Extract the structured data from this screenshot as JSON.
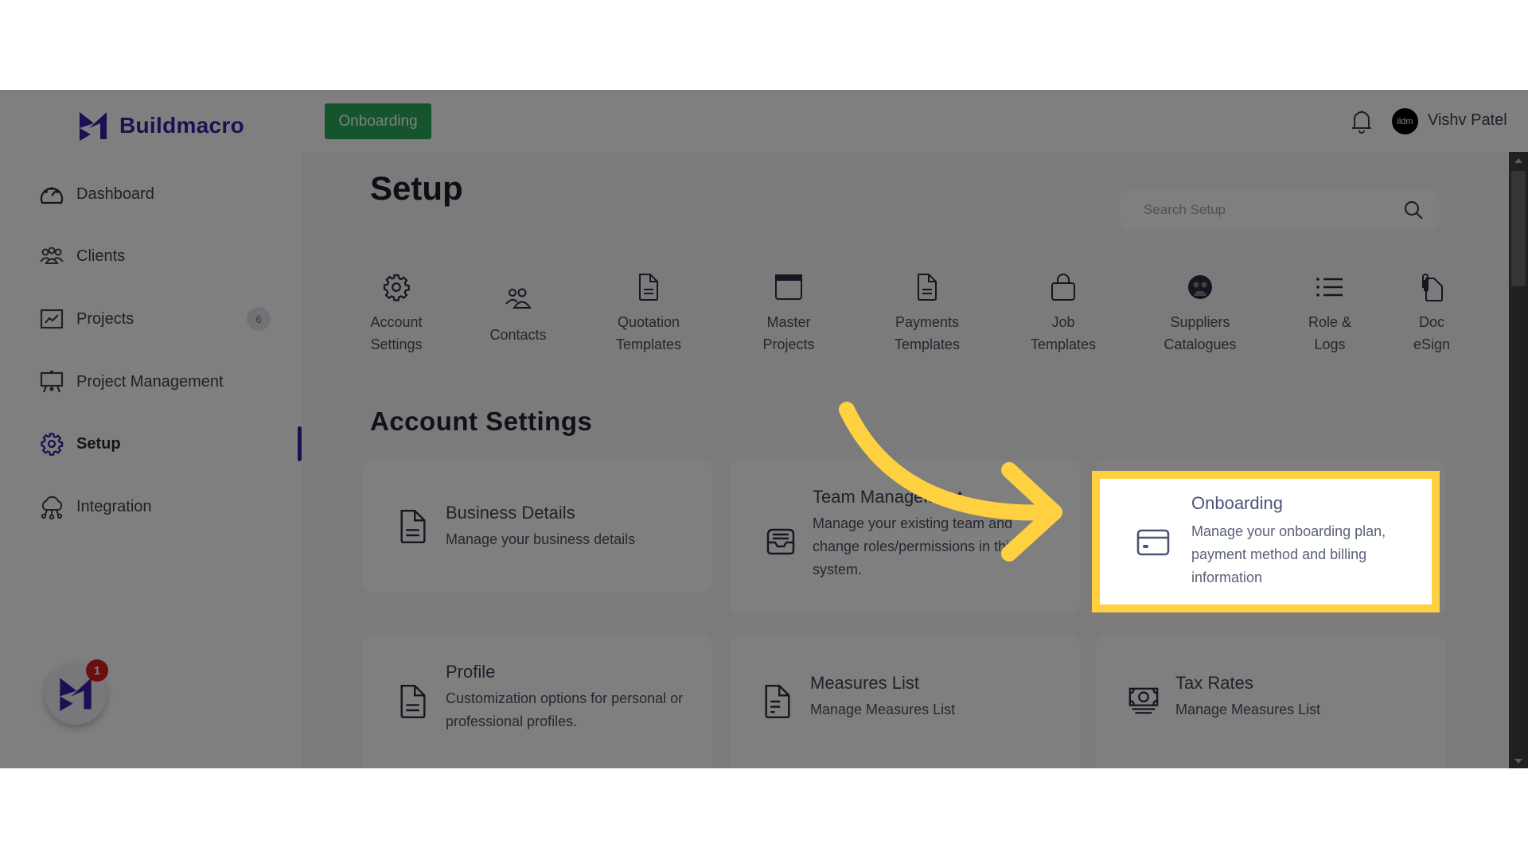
{
  "app": {
    "brand": "Buildmacro",
    "brand_color": "#3b1ea3",
    "highlight_color": "#ffd140"
  },
  "sidebar": {
    "items": [
      {
        "label": "Dashboard",
        "icon": "gauge-icon"
      },
      {
        "label": "Clients",
        "icon": "users-group-icon"
      },
      {
        "label": "Projects",
        "icon": "chart-line-icon",
        "badge": "6"
      },
      {
        "label": "Project Management",
        "icon": "presentation-board-icon"
      },
      {
        "label": "Setup",
        "icon": "gear-icon",
        "active": true
      },
      {
        "label": "Integration",
        "icon": "cloud-network-icon"
      }
    ],
    "fab_badge": "1"
  },
  "header": {
    "onboarding_button": "Onboarding",
    "avatar_text": "ildm",
    "user_name": "Vishv Patel"
  },
  "main": {
    "title": "Setup",
    "search_placeholder": "Search Setup",
    "tabs": [
      {
        "line1": "Account",
        "line2": "Settings",
        "icon": "gear-icon"
      },
      {
        "line1": "Contacts",
        "line2": "",
        "icon": "contacts-icon"
      },
      {
        "line1": "Quotation",
        "line2": "Templates",
        "icon": "document-icon"
      },
      {
        "line1": "Master",
        "line2": "Projects",
        "icon": "window-icon"
      },
      {
        "line1": "Payments",
        "line2": "Templates",
        "icon": "document-icon"
      },
      {
        "line1": "Job",
        "line2": "Templates",
        "icon": "bag-icon"
      },
      {
        "line1": "Suppliers",
        "line2": "Catalogues",
        "icon": "supplier-icon"
      },
      {
        "line1": "Role &",
        "line2": "Logs",
        "icon": "list-icon"
      },
      {
        "line1": "Doc",
        "line2": "eSign",
        "icon": "paperclip-document-icon"
      }
    ],
    "section_title": "Account Settings",
    "cards": [
      {
        "title": "Business Details",
        "description": "Manage your business details",
        "icon": "document-icon"
      },
      {
        "title": "Team Management",
        "description": "Manage your existing team and change roles/permissions in this system.",
        "icon": "inbox-icon"
      },
      {
        "title": "Onboarding",
        "description": "Manage your onboarding plan, payment method and billing information",
        "icon": "credit-card-icon"
      },
      {
        "title": "Profile",
        "description": "Customization options for personal or professional profiles.",
        "icon": "document-icon"
      },
      {
        "title": "Measures List",
        "description": "Manage Measures List",
        "icon": "document-icon"
      },
      {
        "title": "Tax Rates",
        "description": "Manage Measures List",
        "icon": "money-icon"
      }
    ]
  }
}
